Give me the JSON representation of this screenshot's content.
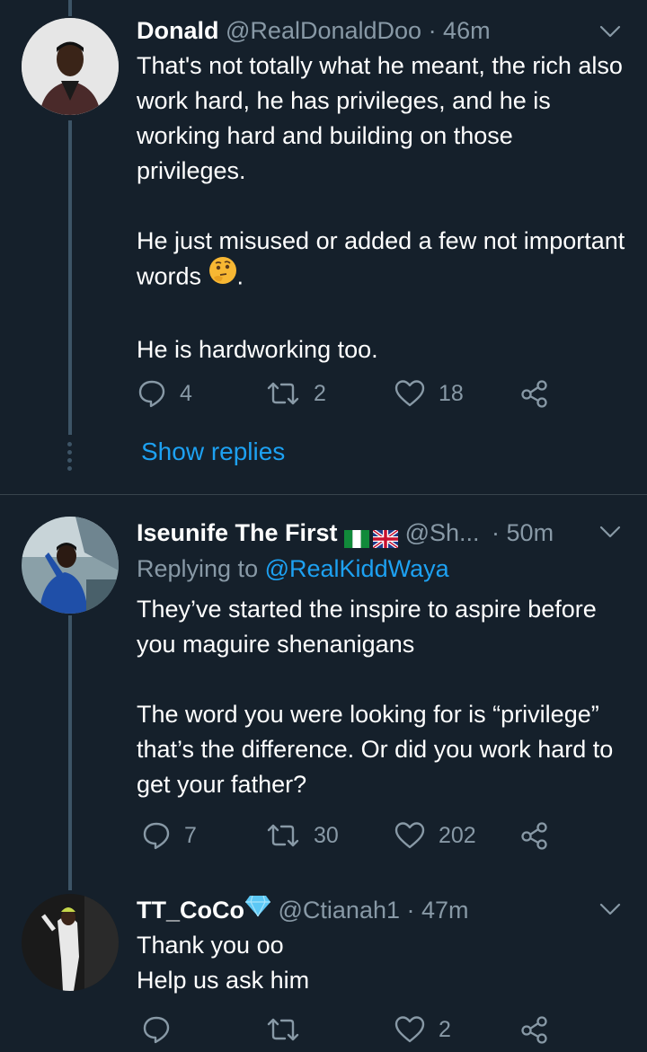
{
  "tweets": [
    {
      "name": "Donald",
      "handle": "@RealDonaldDoo",
      "time": "· 46m",
      "paragraphs": [
        "That's not totally what he meant, the rich also work hard, he has privileges, and he is working hard and building on those privileges.",
        "He just misused or added a few not important words",
        "He is hardworking too."
      ],
      "para2_suffix": ".",
      "reply_count": "4",
      "retweet_count": "2",
      "like_count": "18",
      "show_replies": "Show replies"
    },
    {
      "name": "Iseunife The First",
      "handle": "@Sh...",
      "time": "· 50m",
      "replying_prefix": "Replying to",
      "replying_handle": "@RealKiddWaya",
      "paragraphs": [
        "They’ve started the inspire to aspire before you maguire shenanigans",
        "The word you were looking for is “privilege” that’s the difference. Or did you work hard to get your father?"
      ],
      "reply_count": "7",
      "retweet_count": "30",
      "like_count": "202"
    },
    {
      "name": "TT_CoCo",
      "handle": "@Ctianah1",
      "time": "· 47m",
      "lines": [
        "Thank you oo",
        "Help us ask him"
      ],
      "reply_count": "",
      "retweet_count": "",
      "like_count": "2"
    }
  ],
  "colors": {
    "background": "#15202b",
    "secondary_text": "#8899a6",
    "link": "#1da1f2",
    "thread_line": "#3d5466"
  },
  "icons": [
    "reply-icon",
    "retweet-icon",
    "like-icon",
    "share-icon",
    "chevron-down-icon",
    "diamond-icon",
    "thinking-face-emoji"
  ]
}
